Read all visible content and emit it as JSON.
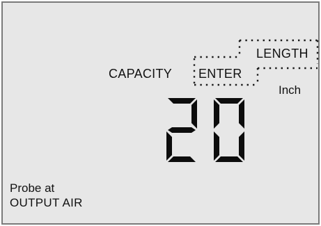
{
  "display": {
    "capacity_label": "CAPACITY",
    "enter_label": "ENTER",
    "length_label": "LENGTH",
    "unit_label": "Inch",
    "value": "20",
    "probe_line1": "Probe at",
    "probe_line2": "OUTPUT AIR"
  },
  "colors": {
    "lcd_background": "#e7e7e7",
    "segment": "#0d0d0d",
    "border": "#7a7a7a"
  }
}
